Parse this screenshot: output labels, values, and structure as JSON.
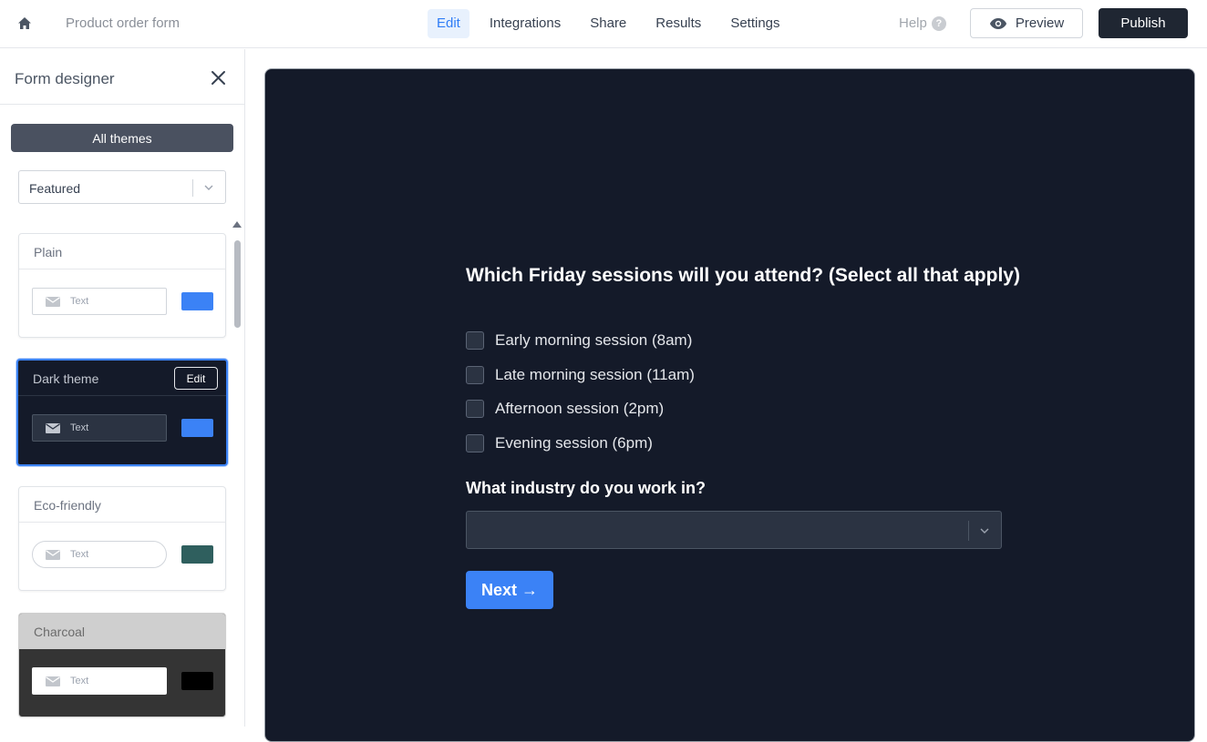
{
  "topbar": {
    "form_name": "Product order form",
    "tabs": [
      {
        "label": "Edit",
        "active": true
      },
      {
        "label": "Integrations"
      },
      {
        "label": "Share"
      },
      {
        "label": "Results"
      },
      {
        "label": "Settings"
      }
    ],
    "help_label": "Help",
    "help_badge": "?",
    "preview_label": "Preview",
    "publish_label": "Publish"
  },
  "sidebar": {
    "title": "Form designer",
    "all_themes_label": "All themes",
    "filter_value": "Featured",
    "themes": [
      {
        "name": "Plain",
        "input_text": "Text",
        "swatch": "#3b82f6"
      },
      {
        "name": "Dark theme",
        "input_text": "Text",
        "swatch": "#3b82f6",
        "selected": true,
        "edit_label": "Edit"
      },
      {
        "name": "Eco-friendly",
        "input_text": "Text",
        "swatch": "#2f5f5e"
      },
      {
        "name": "Charcoal",
        "input_text": "Text",
        "swatch": "#000000"
      }
    ]
  },
  "form": {
    "question1": "Which Friday sessions will you attend? (Select all that apply)",
    "options": [
      "Early morning session (8am)",
      "Late morning session (11am)",
      "Afternoon session (2pm)",
      "Evening session (6pm)"
    ],
    "question2": "What industry do you work in?",
    "dropdown_value": "",
    "next_label": "Next →"
  },
  "colors": {
    "accent": "#3b82f6",
    "publish_bg": "#1f2632",
    "canvas_bg": "#141a29"
  }
}
